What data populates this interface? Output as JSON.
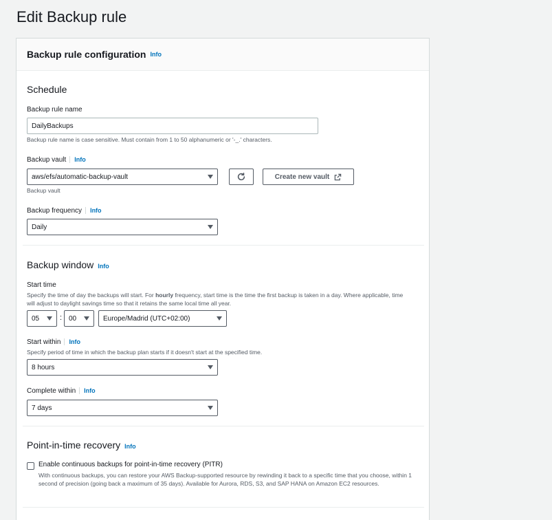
{
  "page": {
    "title": "Edit Backup rule"
  },
  "panel": {
    "title": "Backup rule configuration",
    "info": "Info"
  },
  "schedule": {
    "title": "Schedule",
    "rule_name": {
      "label": "Backup rule name",
      "value": "DailyBackups",
      "hint": "Backup rule name is case sensitive. Must contain from 1 to 50 alphanumeric or '-_.' characters."
    },
    "vault": {
      "label": "Backup vault",
      "info": "Info",
      "value": "aws/efs/automatic-backup-vault",
      "hint": "Backup vault",
      "create_button": "Create new vault"
    },
    "frequency": {
      "label": "Backup frequency",
      "info": "Info",
      "value": "Daily"
    }
  },
  "backup_window": {
    "title": "Backup window",
    "info": "Info",
    "start_time": {
      "label": "Start time",
      "hint_pre": "Specify the time of day the backups will start. For ",
      "hint_bold": "hourly",
      "hint_post": " frequency, start time is the time the first backup is taken in a day. Where applicable, time will adjust to daylight savings time so that it retains the same local time all year.",
      "hour": "05",
      "separator": ":",
      "minute": "00",
      "timezone": "Europe/Madrid (UTC+02:00)"
    },
    "start_within": {
      "label": "Start within",
      "info": "Info",
      "hint": "Specify period of time in which the backup plan starts if it doesn't start at the specified time.",
      "value": "8 hours"
    },
    "complete_within": {
      "label": "Complete within",
      "info": "Info",
      "value": "7 days"
    }
  },
  "pitr": {
    "title": "Point-in-time recovery",
    "info": "Info",
    "checkbox_label": "Enable continuous backups for point-in-time recovery (PITR)",
    "checked": false,
    "description": "With continuous backups, you can restore your AWS Backup-supported resource by rewinding it back to a specific time that you choose, within 1 second of precision (going back a maximum of 35 days). Available for Aurora, RDS, S3, and SAP HANA on Amazon EC2 resources."
  },
  "colors": {
    "accent": "#0073bb",
    "border": "#aab7b8",
    "text": "#16191f",
    "muted": "#545b64"
  },
  "icons": {
    "refresh": "refresh-icon",
    "external": "external-link-icon",
    "dropdown": "caret-down-icon"
  }
}
